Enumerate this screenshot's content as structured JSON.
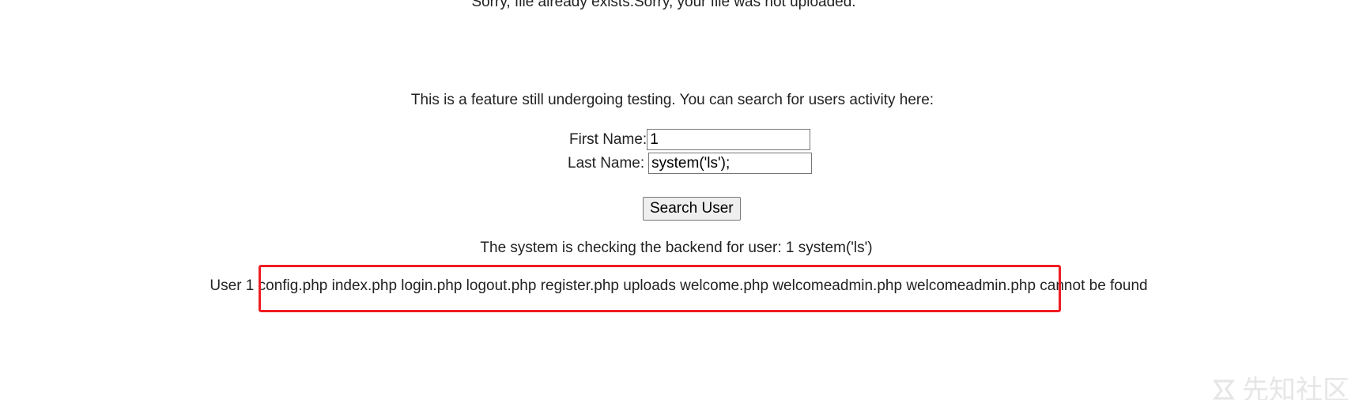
{
  "messages": {
    "upload": "Sorry, file already exists.Sorry, your file was not uploaded.",
    "intro": "This is a feature still undergoing testing. You can search for users activity here:",
    "checking": "The system is checking the backend for user: 1 system('ls')",
    "result": "User 1 config.php index.php login.php logout.php register.php uploads welcome.php welcomeadmin.php welcomeadmin.php cannot be found"
  },
  "form": {
    "first_name_label": "First Name:",
    "first_name_value": "1",
    "last_name_label": "Last Name:",
    "last_name_value": "system('ls');",
    "submit_label": "Search User"
  },
  "watermark": {
    "text": "先知社区",
    "icon": "xianzhi-logo-icon"
  },
  "colors": {
    "highlight": "#ee1d23",
    "text": "#222222",
    "watermark": "#e6e6e6"
  }
}
